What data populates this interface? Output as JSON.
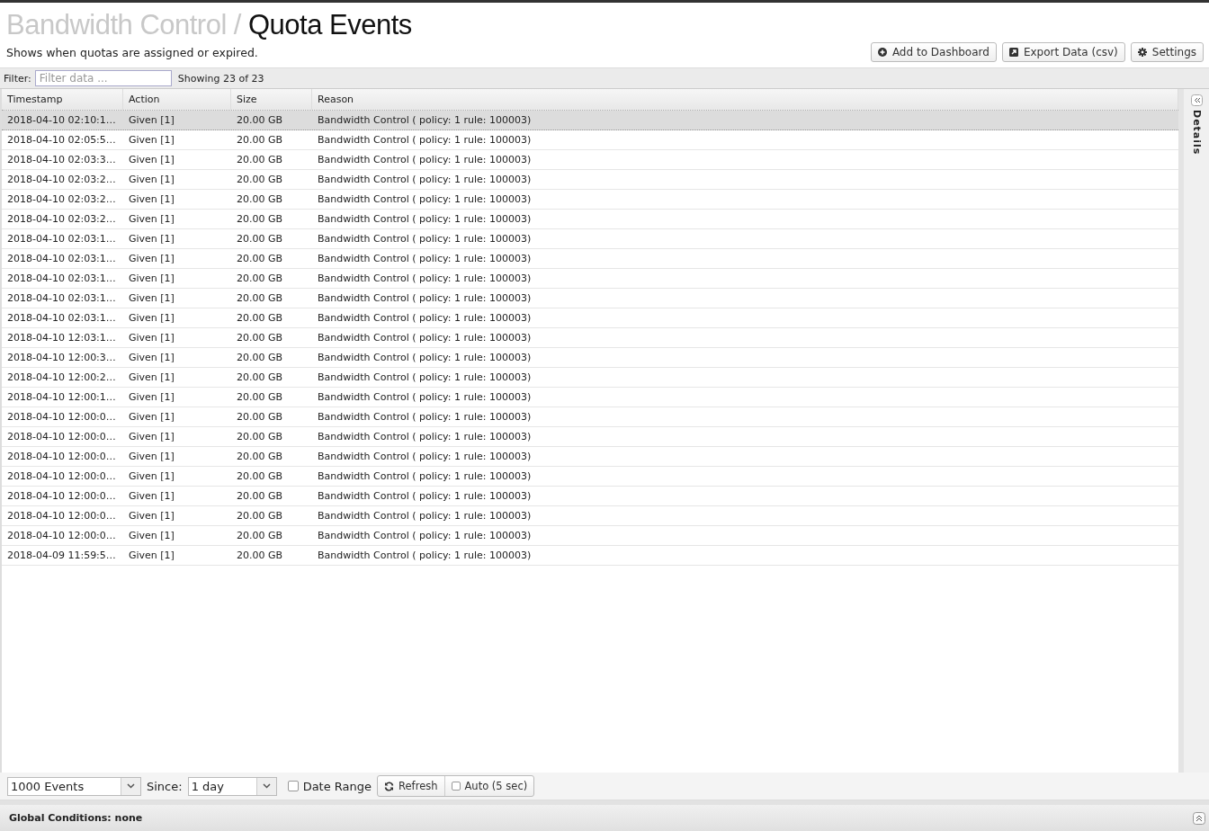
{
  "breadcrumb": {
    "parent": "Bandwidth Control",
    "separator": "/",
    "title": "Quota Events"
  },
  "description": "Shows when quotas are assigned or expired.",
  "buttons": [
    {
      "kind": "add",
      "label": "Add to Dashboard"
    },
    {
      "kind": "export",
      "label": "Export Data (csv)"
    },
    {
      "kind": "settings",
      "label": "Settings"
    }
  ],
  "filter": {
    "label": "Filter:",
    "placeholder": "Filter data ...",
    "count": "Showing 23 of 23"
  },
  "table": {
    "columns": [
      "Timestamp",
      "Action",
      "Size",
      "Reason"
    ],
    "rows": [
      {
        "cells": [
          "2018-04-10 02:10:1…",
          "Given [1]",
          "20.00 GB",
          "Bandwidth Control ( policy: 1 rule: 100003)"
        ],
        "selected": true
      },
      {
        "cells": [
          "2018-04-10 02:05:5…",
          "Given [1]",
          "20.00 GB",
          "Bandwidth Control ( policy: 1 rule: 100003)"
        ],
        "selected": false
      },
      {
        "cells": [
          "2018-04-10 02:03:3…",
          "Given [1]",
          "20.00 GB",
          "Bandwidth Control ( policy: 1 rule: 100003)"
        ],
        "selected": false
      },
      {
        "cells": [
          "2018-04-10 02:03:2…",
          "Given [1]",
          "20.00 GB",
          "Bandwidth Control ( policy: 1 rule: 100003)"
        ],
        "selected": false
      },
      {
        "cells": [
          "2018-04-10 02:03:2…",
          "Given [1]",
          "20.00 GB",
          "Bandwidth Control ( policy: 1 rule: 100003)"
        ],
        "selected": false
      },
      {
        "cells": [
          "2018-04-10 02:03:2…",
          "Given [1]",
          "20.00 GB",
          "Bandwidth Control ( policy: 1 rule: 100003)"
        ],
        "selected": false
      },
      {
        "cells": [
          "2018-04-10 02:03:1…",
          "Given [1]",
          "20.00 GB",
          "Bandwidth Control ( policy: 1 rule: 100003)"
        ],
        "selected": false
      },
      {
        "cells": [
          "2018-04-10 02:03:1…",
          "Given [1]",
          "20.00 GB",
          "Bandwidth Control ( policy: 1 rule: 100003)"
        ],
        "selected": false
      },
      {
        "cells": [
          "2018-04-10 02:03:1…",
          "Given [1]",
          "20.00 GB",
          "Bandwidth Control ( policy: 1 rule: 100003)"
        ],
        "selected": false
      },
      {
        "cells": [
          "2018-04-10 02:03:1…",
          "Given [1]",
          "20.00 GB",
          "Bandwidth Control ( policy: 1 rule: 100003)"
        ],
        "selected": false
      },
      {
        "cells": [
          "2018-04-10 02:03:1…",
          "Given [1]",
          "20.00 GB",
          "Bandwidth Control ( policy: 1 rule: 100003)"
        ],
        "selected": false
      },
      {
        "cells": [
          "2018-04-10 12:03:1…",
          "Given [1]",
          "20.00 GB",
          "Bandwidth Control ( policy: 1 rule: 100003)"
        ],
        "selected": false
      },
      {
        "cells": [
          "2018-04-10 12:00:3…",
          "Given [1]",
          "20.00 GB",
          "Bandwidth Control ( policy: 1 rule: 100003)"
        ],
        "selected": false
      },
      {
        "cells": [
          "2018-04-10 12:00:2…",
          "Given [1]",
          "20.00 GB",
          "Bandwidth Control ( policy: 1 rule: 100003)"
        ],
        "selected": false
      },
      {
        "cells": [
          "2018-04-10 12:00:1…",
          "Given [1]",
          "20.00 GB",
          "Bandwidth Control ( policy: 1 rule: 100003)"
        ],
        "selected": false
      },
      {
        "cells": [
          "2018-04-10 12:00:0…",
          "Given [1]",
          "20.00 GB",
          "Bandwidth Control ( policy: 1 rule: 100003)"
        ],
        "selected": false
      },
      {
        "cells": [
          "2018-04-10 12:00:0…",
          "Given [1]",
          "20.00 GB",
          "Bandwidth Control ( policy: 1 rule: 100003)"
        ],
        "selected": false
      },
      {
        "cells": [
          "2018-04-10 12:00:0…",
          "Given [1]",
          "20.00 GB",
          "Bandwidth Control ( policy: 1 rule: 100003)"
        ],
        "selected": false
      },
      {
        "cells": [
          "2018-04-10 12:00:0…",
          "Given [1]",
          "20.00 GB",
          "Bandwidth Control ( policy: 1 rule: 100003)"
        ],
        "selected": false
      },
      {
        "cells": [
          "2018-04-10 12:00:0…",
          "Given [1]",
          "20.00 GB",
          "Bandwidth Control ( policy: 1 rule: 100003)"
        ],
        "selected": false
      },
      {
        "cells": [
          "2018-04-10 12:00:0…",
          "Given [1]",
          "20.00 GB",
          "Bandwidth Control ( policy: 1 rule: 100003)"
        ],
        "selected": false
      },
      {
        "cells": [
          "2018-04-10 12:00:0…",
          "Given [1]",
          "20.00 GB",
          "Bandwidth Control ( policy: 1 rule: 100003)"
        ],
        "selected": false
      },
      {
        "cells": [
          "2018-04-09 11:59:5…",
          "Given [1]",
          "20.00 GB",
          "Bandwidth Control ( policy: 1 rule: 100003)"
        ],
        "selected": false
      }
    ]
  },
  "details_panel": {
    "label": "Details"
  },
  "toolbar": {
    "limit": "1000 Events",
    "since_label": "Since:",
    "since": "1 day",
    "date_range": {
      "label": "Date Range",
      "checked": false
    },
    "refresh": "Refresh",
    "auto": {
      "label": "Auto (5 sec)",
      "checked": false
    }
  },
  "global_conditions": "Global Conditions: none"
}
